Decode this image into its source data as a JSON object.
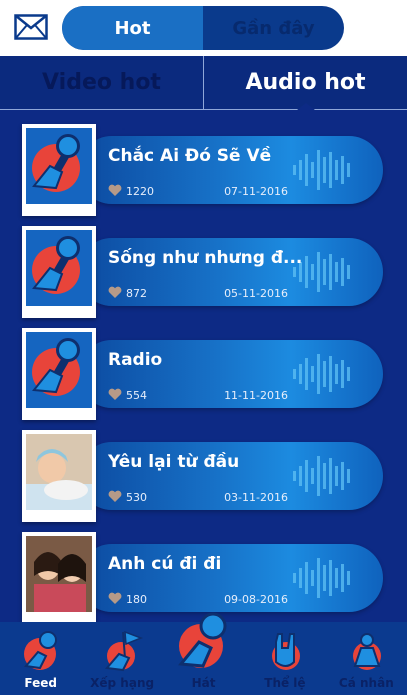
{
  "header": {
    "mail_icon": "mail-icon",
    "segments": [
      {
        "label": "Hot",
        "active": true
      },
      {
        "label": "Gần đây",
        "active": false
      }
    ]
  },
  "tabs": [
    {
      "label": "Video hot",
      "active": false
    },
    {
      "label": "Audio hot",
      "active": true
    }
  ],
  "songs": [
    {
      "title": "Chắc Ai Đó Sẽ Về",
      "likes": "1220",
      "date": "07-11-2016",
      "thumb": "microphone-hand-icon"
    },
    {
      "title": "Sống như nhưng đ...",
      "likes": "872",
      "date": "05-11-2016",
      "thumb": "microphone-hand-icon"
    },
    {
      "title": "Radio",
      "likes": "554",
      "date": "11-11-2016",
      "thumb": "microphone-hand-icon"
    },
    {
      "title": "Yêu lại từ đầu",
      "likes": "530",
      "date": "03-11-2016",
      "thumb": "baby-photo"
    },
    {
      "title": "Anh cú đi đi",
      "likes": "180",
      "date": "09-08-2016",
      "thumb": "people-photo"
    }
  ],
  "nav": [
    {
      "label": "Feed",
      "active": true
    },
    {
      "label": "Xếp hạng",
      "active": false
    },
    {
      "label": "Hát",
      "active": false
    },
    {
      "label": "Thể lệ",
      "active": false
    },
    {
      "label": "Cá nhân",
      "active": false
    }
  ],
  "colors": {
    "background": "#0d2a85",
    "pill_accent": "#1c8be0",
    "thumb_red": "#e8443a"
  }
}
